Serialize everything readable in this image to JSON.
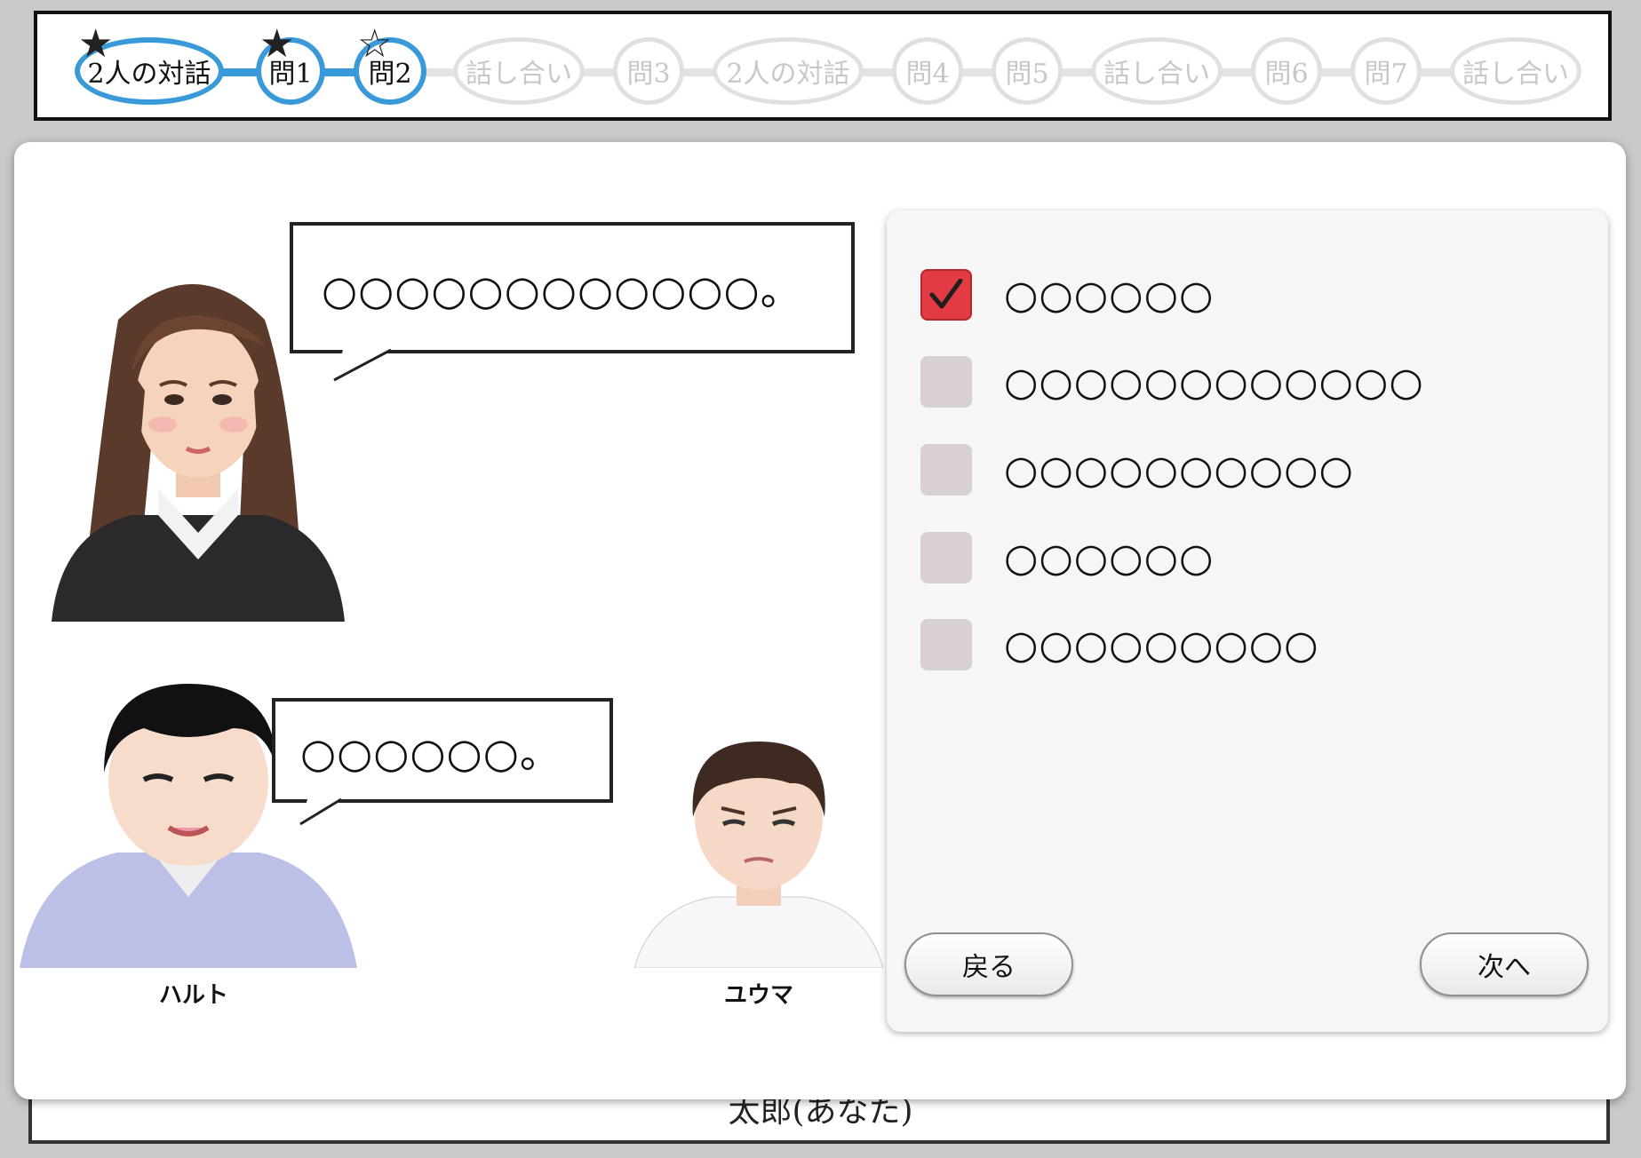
{
  "progress": {
    "steps": [
      {
        "label": "2人の対話",
        "mark": "★"
      },
      {
        "label": "問1",
        "mark": "★"
      },
      {
        "label": "問2",
        "mark": "☆"
      },
      {
        "label": "話し合い"
      },
      {
        "label": "問3"
      },
      {
        "label": "2人の対話"
      },
      {
        "label": "問4"
      },
      {
        "label": "問5"
      },
      {
        "label": "話し合い"
      },
      {
        "label": "問6"
      },
      {
        "label": "問7"
      },
      {
        "label": "話し合い"
      }
    ]
  },
  "dialogue": {
    "teacher_bubble": "○○○○○○○○○○○○。",
    "haruto_bubble": "○○○○○○。"
  },
  "characters": {
    "haruto": "ハルト",
    "yuma": "ユウマ"
  },
  "answers": {
    "options": [
      {
        "text": "○○○○○○",
        "checked": true
      },
      {
        "text": "○○○○○○○○○○○○",
        "checked": false
      },
      {
        "text": "○○○○○○○○○○",
        "checked": false
      },
      {
        "text": "○○○○○○",
        "checked": false
      },
      {
        "text": "○○○○○○○○○",
        "checked": false
      }
    ],
    "back_label": "戻る",
    "next_label": "次へ"
  },
  "background": {
    "player_label": "太郎(あなた)"
  },
  "colors": {
    "progress_done": "#3a9ad9",
    "progress_todo": "#e0e0e0",
    "checkbox_checked": "#e23b43",
    "checkbox_unchecked": "#d9d0d1"
  }
}
